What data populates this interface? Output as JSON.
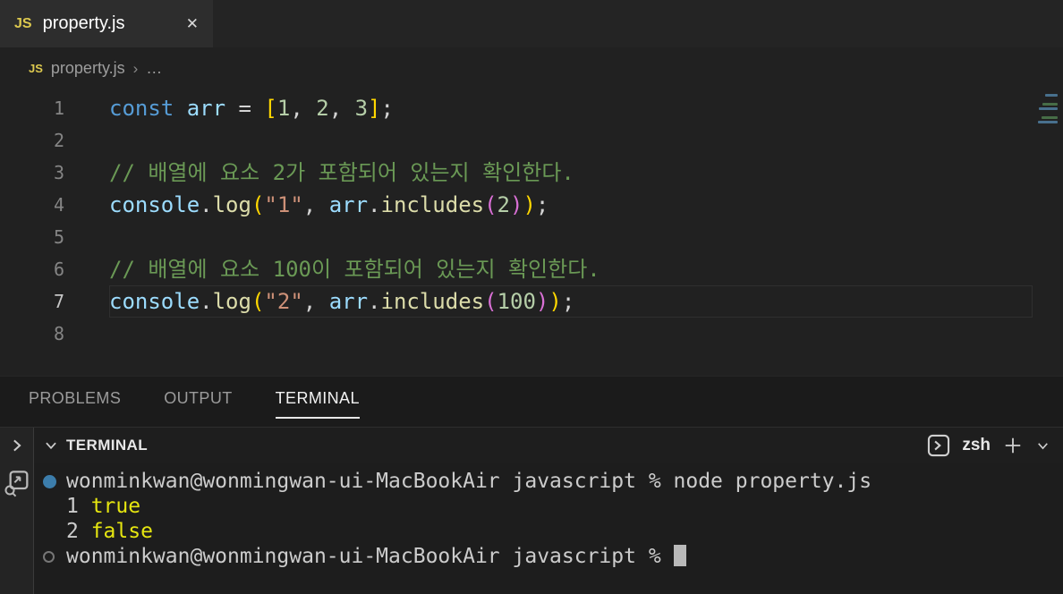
{
  "palette": {
    "keyword": "#569cd6",
    "variable": "#9cdcfe",
    "function": "#dcdcaa",
    "string": "#ce9178",
    "number": "#b5cea8",
    "comment": "#6a9955",
    "bracket_outer": "#ffd700",
    "bracket_inner": "#da70d6",
    "punctuation": "#d4d4d4",
    "terminal_text": "#cccccc",
    "terminal_yellow": "#e5e510",
    "command_decoration_blue": "#3c7dab",
    "js_icon_yellow": "#ddc94f",
    "editor_background": "#212121",
    "panel_background": "#1d1d1d"
  },
  "tab_bar": {
    "tab": {
      "icon": "JS",
      "title": "property.js",
      "close_icon": "✕"
    }
  },
  "breadcrumb": {
    "icon": "JS",
    "file": "property.js",
    "separator": "›",
    "more": "…"
  },
  "editor": {
    "current_line": 7,
    "lines": [
      {
        "num": 1,
        "tokens": [
          {
            "t": "const",
            "c": "kw"
          },
          {
            "t": " ",
            "c": "op"
          },
          {
            "t": "arr",
            "c": "var"
          },
          {
            "t": " = ",
            "c": "op"
          },
          {
            "t": "[",
            "c": "b1"
          },
          {
            "t": "1",
            "c": "num"
          },
          {
            "t": ", ",
            "c": "op"
          },
          {
            "t": "2",
            "c": "num"
          },
          {
            "t": ", ",
            "c": "op"
          },
          {
            "t": "3",
            "c": "num"
          },
          {
            "t": "]",
            "c": "b1"
          },
          {
            "t": ";",
            "c": "op"
          }
        ]
      },
      {
        "num": 2,
        "tokens": []
      },
      {
        "num": 3,
        "tokens": [
          {
            "t": "// 배열에 요소 2가 포함되어 있는지 확인한다.",
            "c": "cm"
          }
        ]
      },
      {
        "num": 4,
        "tokens": [
          {
            "t": "console",
            "c": "var"
          },
          {
            "t": ".",
            "c": "op"
          },
          {
            "t": "log",
            "c": "fn"
          },
          {
            "t": "(",
            "c": "b1"
          },
          {
            "t": "\"1\"",
            "c": "str"
          },
          {
            "t": ", ",
            "c": "op"
          },
          {
            "t": "arr",
            "c": "var"
          },
          {
            "t": ".",
            "c": "op"
          },
          {
            "t": "includes",
            "c": "fn"
          },
          {
            "t": "(",
            "c": "b2"
          },
          {
            "t": "2",
            "c": "num"
          },
          {
            "t": ")",
            "c": "b2"
          },
          {
            "t": ")",
            "c": "b1"
          },
          {
            "t": ";",
            "c": "op"
          }
        ]
      },
      {
        "num": 5,
        "tokens": []
      },
      {
        "num": 6,
        "tokens": [
          {
            "t": "// 배열에 요소 100이 포함되어 있는지 확인한다.",
            "c": "cm"
          }
        ]
      },
      {
        "num": 7,
        "tokens": [
          {
            "t": "console",
            "c": "var"
          },
          {
            "t": ".",
            "c": "op"
          },
          {
            "t": "log",
            "c": "fn"
          },
          {
            "t": "(",
            "c": "b1"
          },
          {
            "t": "\"2\"",
            "c": "str"
          },
          {
            "t": ", ",
            "c": "op"
          },
          {
            "t": "arr",
            "c": "var"
          },
          {
            "t": ".",
            "c": "op"
          },
          {
            "t": "includes",
            "c": "fn"
          },
          {
            "t": "(",
            "c": "b2"
          },
          {
            "t": "100",
            "c": "num"
          },
          {
            "t": ")",
            "c": "b2"
          },
          {
            "t": ")",
            "c": "b1"
          },
          {
            "t": ";",
            "c": "op"
          }
        ]
      },
      {
        "num": 8,
        "tokens": []
      }
    ]
  },
  "panel": {
    "tabs": [
      {
        "label": "PROBLEMS",
        "active": false
      },
      {
        "label": "OUTPUT",
        "active": false
      },
      {
        "label": "TERMINAL",
        "active": true
      }
    ],
    "header": {
      "title": "TERMINAL",
      "shell_label": "zsh"
    }
  },
  "terminal": {
    "rows": [
      {
        "deco": "run",
        "segments": [
          {
            "t": "wonminkwan@wonmingwan-ui-MacBookAir javascript % node property.js",
            "c": "txt"
          }
        ]
      },
      {
        "deco": null,
        "segments": [
          {
            "t": "1 ",
            "c": "txt"
          },
          {
            "t": "true",
            "c": "yel"
          }
        ]
      },
      {
        "deco": null,
        "segments": [
          {
            "t": "2 ",
            "c": "txt"
          },
          {
            "t": "false",
            "c": "yel"
          }
        ]
      },
      {
        "deco": "pending",
        "cursor": true,
        "segments": [
          {
            "t": "wonminkwan@wonmingwan-ui-MacBookAir javascript % ",
            "c": "txt"
          }
        ]
      }
    ]
  }
}
